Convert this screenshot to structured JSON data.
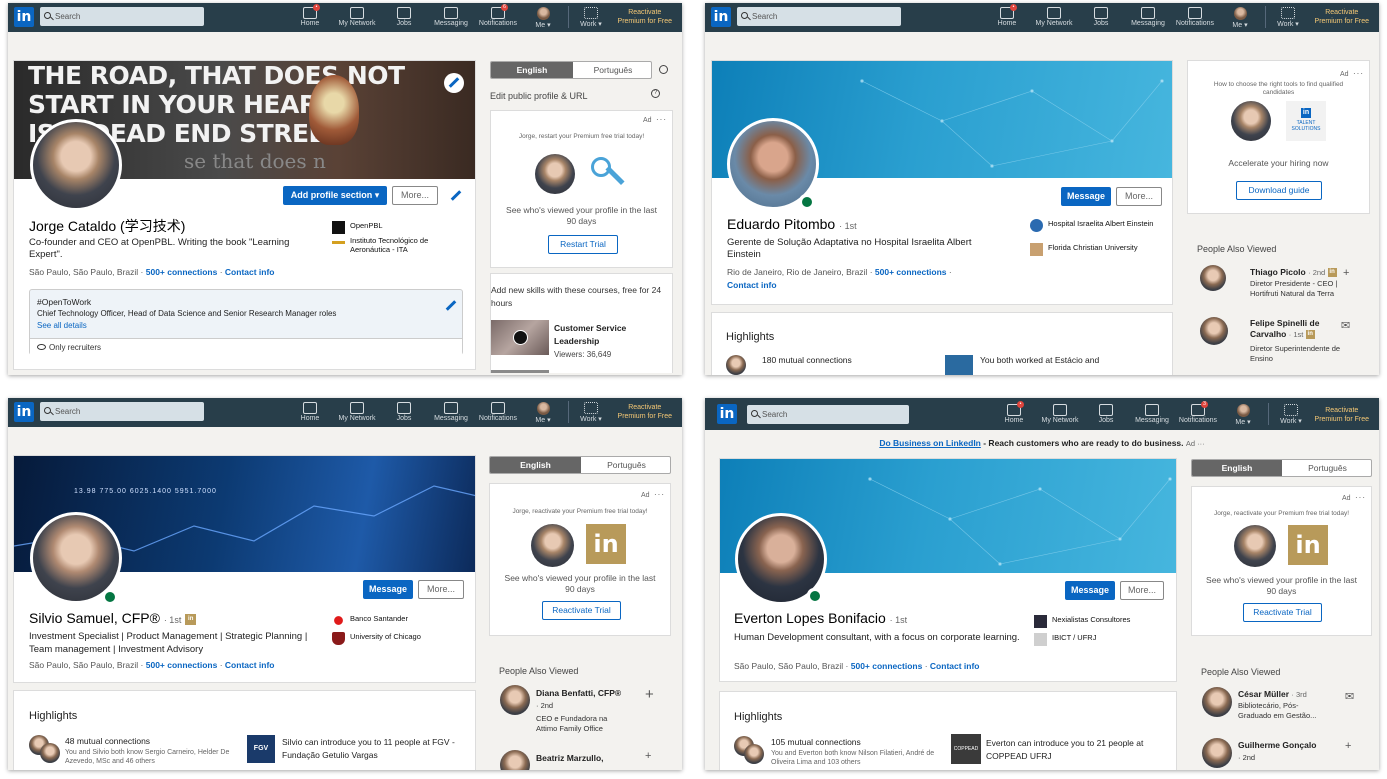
{
  "nav": {
    "search_placeholder": "Search",
    "home": "Home",
    "network": "My Network",
    "jobs": "Jobs",
    "messaging": "Messaging",
    "notifications": "Notifications",
    "me": "Me ▾",
    "work": "Work ▾",
    "premium_line1": "Reactivate",
    "premium_line2": "Premium for Free",
    "logo": "in"
  },
  "panels": [
    {
      "notif_badge": "6",
      "home_badge": "•",
      "banner_text_1": "THE ROAD, THAT DOES NOT",
      "banner_text_2": "START IN YOUR HEART,",
      "banner_text_3": "IS A DEAD END STREET",
      "banner_text_4": "se that does n",
      "name": "Jorge Cataldo (学习技术)",
      "headline": "Co-founder and CEO at OpenPBL. Writing the book \"Learning Expert\".",
      "location": "São Paulo, São Paulo, Brazil",
      "connections": "500+ connections",
      "contact": "Contact info",
      "sep": "·",
      "add_section": "Add profile section ▾",
      "more": "More...",
      "org1": "OpenPBL",
      "org2": "Instituto Tecnológico de Aeronáutica - ITA",
      "otw_title": "#OpenToWork",
      "otw_roles": "Chief Technology Officer, Head of Data Science and Senior Research Manager roles",
      "otw_link": "See all details",
      "otw_vis": "Only recruiters",
      "lang_a": "English",
      "lang_b": "Português",
      "edit_public": "Edit public profile & URL",
      "ad_label": "Ad",
      "ad_dots": "···",
      "ad_top": "Jorge, restart your Premium free trial today!",
      "ad_text": "See who's viewed your profile in the last 90 days",
      "ad_btn": "Restart Trial",
      "courses_text": "Add new skills with these courses, free for 24 hours",
      "course_title": "Customer Service Leadership",
      "course_viewers": "Viewers: 36,649",
      "help_icon": "?"
    },
    {
      "home_badge": "•",
      "name": "Eduardo Pitombo",
      "degree": "· 1st",
      "headline": "Gerente de Solução Adaptativa no Hospital Israelita Albert Einstein",
      "location": "Rio de Janeiro, Rio de Janeiro, Brazil",
      "connections": "500+ connections",
      "contact": "Contact info",
      "sep": "·",
      "message": "Message",
      "more": "More...",
      "org1": "Hospital Israelita Albert Einstein",
      "org2": "Florida Christian University",
      "highlights": "Highlights",
      "hl1": "180 mutual connections",
      "hl2": "You both worked at Estácio and",
      "ad_label": "Ad",
      "ad_dots": "···",
      "ad_top": "How to choose the right tools to find qualified candidates",
      "ts_logo": "in",
      "ts_line1": "TALENT",
      "ts_line2": "SOLUTIONS",
      "ad_text": "Accelerate your hiring now",
      "ad_btn": "Download guide",
      "pav": "People Also Viewed",
      "people": [
        {
          "name": "Thiago Picolo",
          "meta": "· 2nd",
          "desc": "Diretor Presidente - CEO | Hortifruti Natural da Terra",
          "action": "+"
        },
        {
          "name": "Felipe Spinelli de Carvalho",
          "meta": "· 1st",
          "desc": "Diretor Superintendente de Ensino",
          "action": "✉"
        }
      ]
    },
    {
      "banner_numbers": "13.98  775.00  6025.1400  5951.7000",
      "name": "Silvio Samuel, CFP®",
      "degree": "· 1st",
      "headline": "Investment Specialist | Product Management | Strategic Planning | Team management | Investment Advisory",
      "location": "São Paulo, São Paulo, Brazil",
      "connections": "500+ connections",
      "contact": "Contact info",
      "sep": "·",
      "message": "Message",
      "more": "More...",
      "org1": "Banco Santander",
      "org2": "University of Chicago",
      "highlights": "Highlights",
      "hl1": "48 mutual connections",
      "hl1_sub": "You and Silvio both know Sergio Carneiro, Helder De Azevedo, MSc and 46 others",
      "hl2": "Silvio can introduce you to 11 people at FGV - Fundação Getulio Vargas",
      "fgv": "FGV",
      "lang_a": "English",
      "lang_b": "Português",
      "ad_label": "Ad",
      "ad_dots": "···",
      "ad_top": "Jorge, reactivate your Premium free trial today!",
      "ad_text": "See who's viewed your profile in the last 90 days",
      "ad_btn": "Reactivate Trial",
      "li_logo": "in",
      "pav": "People Also Viewed",
      "people": [
        {
          "name": "Diana Benfatti, CFP®",
          "meta": "· 2nd",
          "desc": "CEO e Fundadora na Attimo Family Office",
          "action": "+"
        },
        {
          "name": "Beatriz Marzullo,",
          "meta": "",
          "desc": "",
          "action": "+"
        }
      ]
    },
    {
      "notif_badge": "3",
      "home_badge": "•",
      "ad_banner_link": "Do Business on LinkedIn",
      "ad_banner_rest": " - Reach customers who are ready to do business.",
      "ad_banner_ad": "Ad ···",
      "name": "Everton Lopes Bonifacio",
      "degree": "· 1st",
      "headline": "Human Development consultant, with a focus on corporate learning.",
      "location": "São Paulo, São Paulo, Brazil",
      "connections": "500+ connections",
      "contact": "Contact info",
      "sep": "·",
      "message": "Message",
      "more": "More...",
      "org1": "Nexialistas Consultores",
      "org2": "IBICT / UFRJ",
      "highlights": "Highlights",
      "hl1": "105 mutual connections",
      "hl1_sub": "You and Everton both know Nilson Filatieri, André de Oliveira Lima and 103 others",
      "hl2": "Everton can introduce you to 21 people at COPPEAD UFRJ",
      "coppead": "COPPEAD UFRJ",
      "lang_a": "English",
      "lang_b": "Português",
      "ad_label": "Ad",
      "ad_dots": "···",
      "ad_top": "Jorge, reactivate your Premium free trial today!",
      "ad_text": "See who's viewed your profile in the last 90 days",
      "ad_btn": "Reactivate Trial",
      "li_logo": "in",
      "pav": "People Also Viewed",
      "people": [
        {
          "name": "César Müller",
          "meta": "· 3rd",
          "desc": "Bibliotecário, Pós-Graduado em Gestão...",
          "action": "✉"
        },
        {
          "name": "Guilherme Gonçalo",
          "meta": "· 2nd",
          "desc": "",
          "action": "+"
        }
      ]
    }
  ],
  "colors": {
    "topbar": "#283e4a",
    "brand": "#0a66c2",
    "premium_gold": "#f5c875",
    "linkedin_gold": "#b89a5a",
    "online": "#057642"
  }
}
